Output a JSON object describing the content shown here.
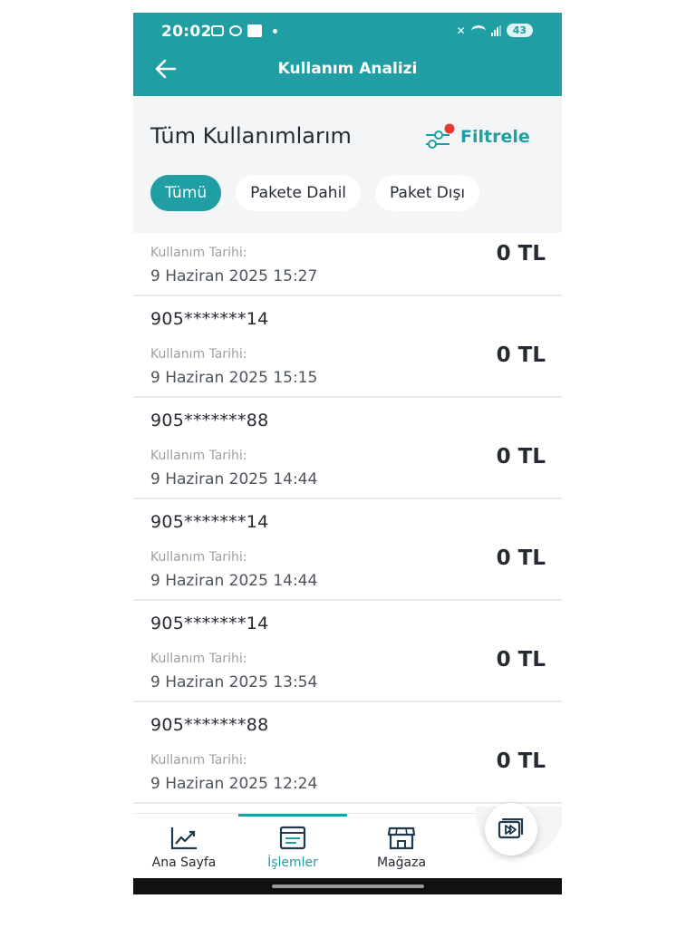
{
  "status_bar": {
    "time": "20:02",
    "battery": "43"
  },
  "header": {
    "title": "Kullanım Analizi"
  },
  "section": {
    "title": "Tüm Kullanımlarım",
    "filter_label": "Filtrele"
  },
  "chips": [
    {
      "label": "Tümü",
      "active": true
    },
    {
      "label": "Pakete Dahil",
      "active": false
    },
    {
      "label": "Paket Dışı",
      "active": false
    }
  ],
  "usage_rows": [
    {
      "phone": "",
      "label": "Kullanım Tarihi:",
      "date": "9 Haziran 2025 15:27",
      "amount": "0 TL"
    },
    {
      "phone": "905*******14",
      "label": "Kullanım Tarihi:",
      "date": "9 Haziran 2025 15:15",
      "amount": "0 TL"
    },
    {
      "phone": "905*******88",
      "label": "Kullanım Tarihi:",
      "date": "9 Haziran 2025 14:44",
      "amount": "0 TL"
    },
    {
      "phone": "905*******14",
      "label": "Kullanım Tarihi:",
      "date": "9 Haziran 2025 14:44",
      "amount": "0 TL"
    },
    {
      "phone": "905*******14",
      "label": "Kullanım Tarihi:",
      "date": "9 Haziran 2025 13:54",
      "amount": "0 TL"
    },
    {
      "phone": "905*******88",
      "label": "Kullanım Tarihi:",
      "date": "9 Haziran 2025 12:24",
      "amount": "0 TL"
    }
  ],
  "bottom_nav": {
    "items": [
      {
        "label": "Ana Sayfa",
        "icon": "chart-line-icon",
        "active": false
      },
      {
        "label": "İşlemler",
        "icon": "document-list-icon",
        "active": true
      },
      {
        "label": "Mağaza",
        "icon": "store-icon",
        "active": false
      }
    ],
    "fab_icon": "media-play-icon"
  },
  "colors": {
    "primary": "#1f9ea3",
    "background": "#f4f5f6",
    "filter_badge": "#e53935"
  }
}
